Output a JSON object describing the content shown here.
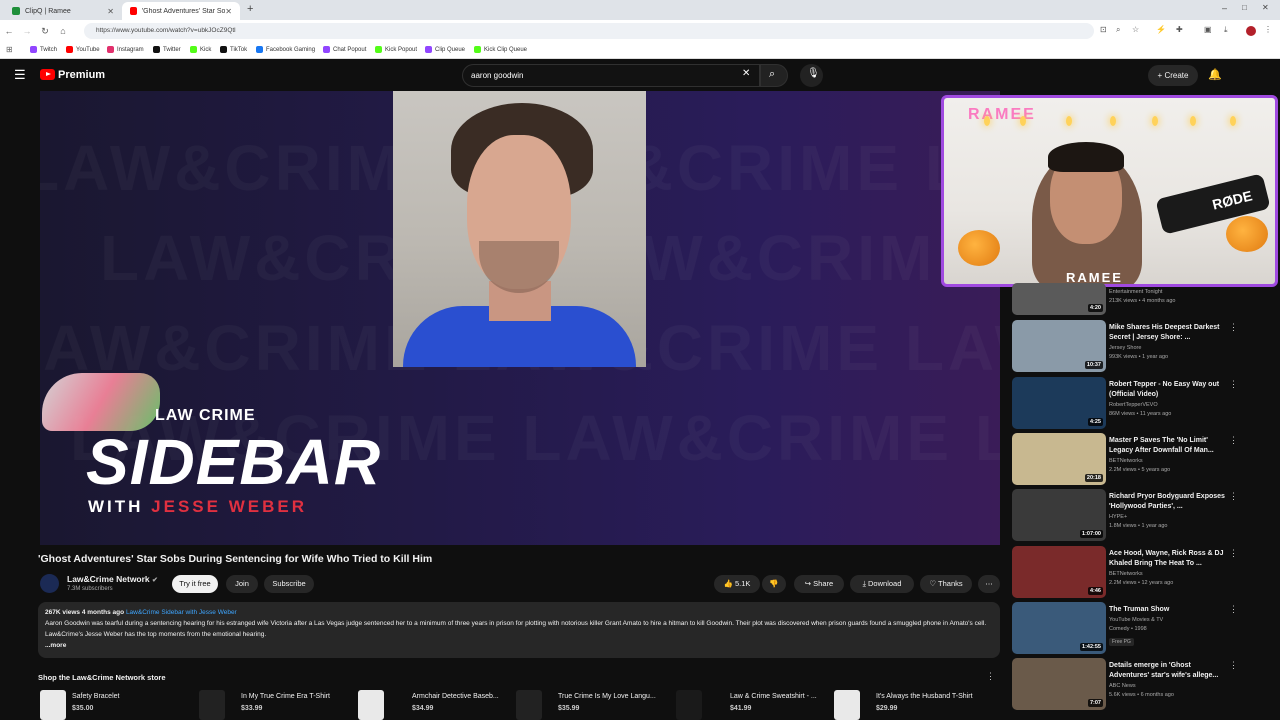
{
  "browser": {
    "tabs": [
      {
        "label": "ClipQ | Ramee",
        "color": "#1f8f3a"
      },
      {
        "label": "'Ghost Adventures' Star Sobs D",
        "color": "#ff0000"
      }
    ],
    "url": "https://www.youtube.com/watch?v=ubkJOcZ9Qtl",
    "bookmarks": [
      {
        "label": "Twitch",
        "color": "#9146ff"
      },
      {
        "label": "YouTube",
        "color": "#ff0000"
      },
      {
        "label": "Instagram",
        "color": "#e1306c"
      },
      {
        "label": "Twitter",
        "color": "#111111"
      },
      {
        "label": "Kick",
        "color": "#53fc18"
      },
      {
        "label": "TikTok",
        "color": "#111111"
      },
      {
        "label": "Facebook Gaming",
        "color": "#1877f2"
      },
      {
        "label": "Chat Popout",
        "color": "#9146ff"
      },
      {
        "label": "Kick Popout",
        "color": "#53fc18"
      },
      {
        "label": "Clip Queue",
        "color": "#9146ff"
      },
      {
        "label": "Kick Clip Queue",
        "color": "#53fc18"
      }
    ]
  },
  "header": {
    "logo": "Premium",
    "search_query": "aaron goodwin",
    "create_label": "Create"
  },
  "player": {
    "overlay_brand": "LAW CRIME",
    "overlay_title": "SIDEBAR",
    "overlay_with": "WITH",
    "overlay_host": "JESSE WEBER",
    "webcam_name": "RAMEE",
    "webcam_sign": "RAMEE",
    "webcam_mic": "RØDE"
  },
  "video": {
    "title": "'Ghost Adventures' Star Sobs During Sentencing for Wife Who Tried to Kill Him",
    "channel": "Law&Crime Network",
    "subscribers": "7.3M subscribers",
    "try_label": "Try it free",
    "join_label": "Join",
    "subscribe_label": "Subscribe",
    "likes": "5.1K",
    "share_label": "Share",
    "download_label": "Download",
    "thanks_label": "Thanks"
  },
  "description": {
    "meta": "267K views  4 months ago",
    "playlist": "Law&Crime Sidebar with Jesse Weber",
    "text": "Aaron Goodwin was tearful during a sentencing hearing for his estranged wife Victoria after a Las Vegas judge sentenced her to a minimum of three years in prison for plotting with notorious killer Grant Amato to hire a hitman to kill Goodwin. Their plot was discovered when prison guards found a smuggled phone in Amato's cell. Law&Crime's Jesse Weber has the top moments from the emotional hearing.",
    "more": "...more"
  },
  "store": {
    "title": "Shop the Law&Crime Network store",
    "items": [
      {
        "name": "Safety Bracelet",
        "price": "$35.00"
      },
      {
        "name": "In My True Crime Era T-Shirt",
        "price": "$33.99"
      },
      {
        "name": "Armchair Detective Baseb...",
        "price": "$34.99"
      },
      {
        "name": "True Crime Is My Love Langu...",
        "price": "$35.99"
      },
      {
        "name": "Law & Crime Sweatshirt - ...",
        "price": "$41.99"
      },
      {
        "name": "It's Always the Husband T-Shirt",
        "price": "$29.99"
      }
    ]
  },
  "recommendations": [
    {
      "title": "",
      "channel": "Entertainment Tonight",
      "stats": "213K views • 4 months ago",
      "duration": "4:20",
      "thumb": "#5a5a5a"
    },
    {
      "title": "Mike Shares His Deepest Darkest Secret | Jersey Shore: ...",
      "channel": "Jersey Shore",
      "stats": "993K views • 1 year ago",
      "duration": "10:37",
      "thumb": "#8a9aa8"
    },
    {
      "title": "Robert Tepper - No Easy Way out (Official Video)",
      "channel": "RobertTepperVEVO",
      "stats": "86M views • 11 years ago",
      "duration": "4:25",
      "thumb": "#1c3a5a"
    },
    {
      "title": "Master P Saves The 'No Limit' Legacy After Downfall Of Man...",
      "channel": "BETNetworks",
      "stats": "2.2M views • 5 years ago",
      "duration": "20:18",
      "thumb": "#c8b890"
    },
    {
      "title": "Richard Pryor Bodyguard Exposes 'Hollywood Parties', ...",
      "channel": "HYPE+",
      "stats": "1.8M views • 1 year ago",
      "duration": "1:07:00",
      "thumb": "#3a3a3a"
    },
    {
      "title": "Ace Hood, Wayne, Rick Ross & DJ Khaled Bring The Heat To ...",
      "channel": "BETNetworks",
      "stats": "2.2M views • 12 years ago",
      "duration": "4:46",
      "thumb": "#7a2a2a"
    },
    {
      "title": "The Truman Show",
      "channel": "YouTube Movies & TV",
      "stats": "Comedy • 1998",
      "duration": "1:42:55",
      "thumb": "#3a5a7a",
      "free": "Free",
      "rating": "PG"
    },
    {
      "title": "Details emerge in 'Ghost Adventures' star's wife's allege...",
      "channel": "ABC News",
      "stats": "5.6K views • 6 months ago",
      "duration": "7:07",
      "thumb": "#6a5a4a"
    }
  ]
}
